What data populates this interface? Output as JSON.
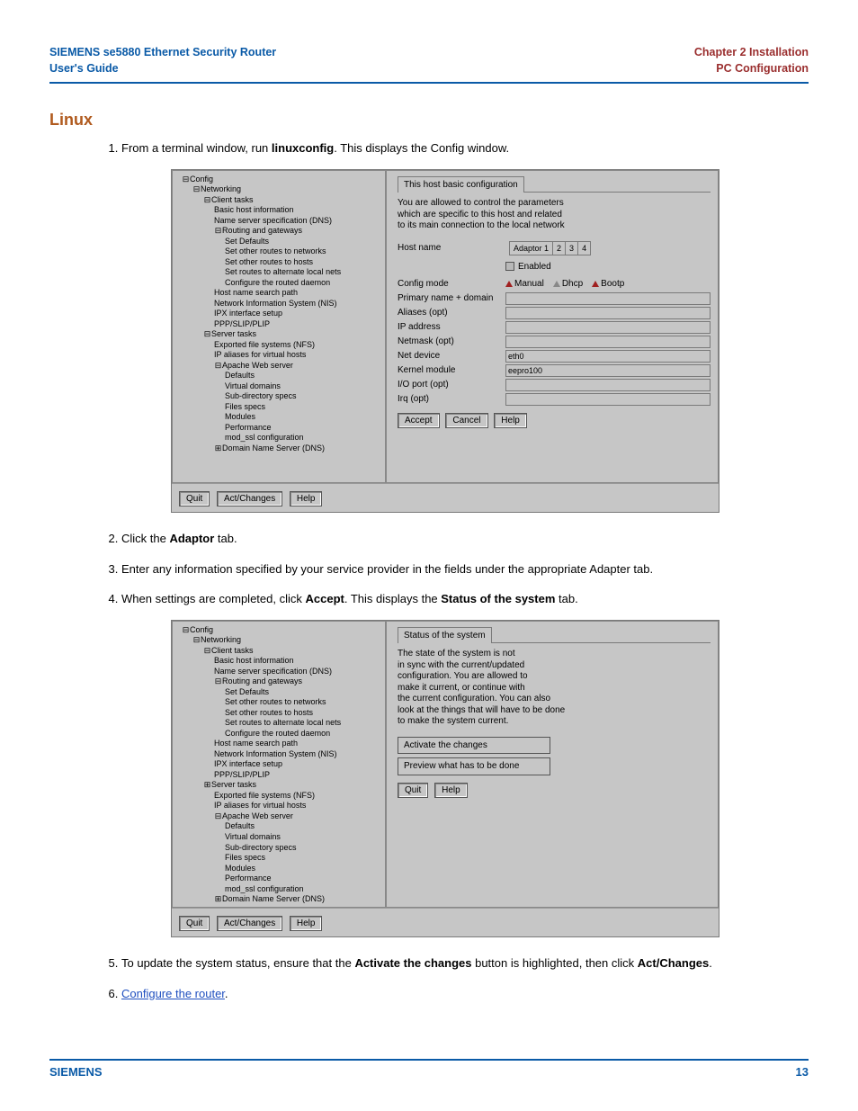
{
  "header": {
    "product_line1": "SIEMENS se5880 Ethernet Security Router",
    "product_line2": "User's Guide",
    "chapter_line1": "Chapter 2  Installation",
    "chapter_line2": "PC Configuration"
  },
  "section_title": "Linux",
  "steps": {
    "s1_pre": "From a terminal window, run ",
    "s1_bold": "linuxconfig",
    "s1_post": ". This displays the Config window.",
    "s2_pre": "Click the ",
    "s2_bold": "Adaptor",
    "s2_post": " tab.",
    "s3": "Enter any information specified by your service provider in the fields under the appropriate Adapter tab.",
    "s4_a": "When settings are completed, click ",
    "s4_b": "Accept",
    "s4_c": ". This displays the ",
    "s4_d": "Status of the system",
    "s4_e": " tab.",
    "s5_a": "To update the system status, ensure that the ",
    "s5_b": "Activate the changes",
    "s5_c": " button is highlighted, then click ",
    "s5_d": "Act/Changes",
    "s5_e": ".",
    "s6_link": "Configure the router",
    "s6_post": "."
  },
  "tree": {
    "config": "Config",
    "networking": "Networking",
    "client_tasks": "Client tasks",
    "basic_host": "Basic host information",
    "dns_spec": "Name server specification (DNS)",
    "routing": "Routing and gateways",
    "set_defaults": "Set Defaults",
    "routes_nets": "Set other routes to networks",
    "routes_hosts": "Set other routes to hosts",
    "routes_alt": "Set routes to alternate local nets",
    "routed": "Configure the routed daemon",
    "host_search": "Host name search path",
    "nis": "Network Information System (NIS)",
    "ipx": "IPX interface setup",
    "ppp": "PPP/SLIP/PLIP",
    "server_tasks": "Server tasks",
    "nfs": "Exported file systems (NFS)",
    "ip_aliases": "IP aliases for virtual hosts",
    "apache": "Apache Web server",
    "apache_defaults": "Defaults",
    "vdomains": "Virtual domains",
    "subdir": "Sub-directory specs",
    "files_specs": "Files specs",
    "modules": "Modules",
    "performance": "Performance",
    "mod_ssl": "mod_ssl configuration",
    "dns_server": "Domain Name Server (DNS)"
  },
  "shot1": {
    "tab_title": "This host basic configuration",
    "intro1": "You are allowed to control the parameters",
    "intro2": "which are specific to this host and related",
    "intro3": "to its main connection to the local network",
    "hostname_label": "Host name",
    "adaptor1": "Adaptor 1",
    "t2": "2",
    "t3": "3",
    "t4": "4",
    "enabled": "Enabled",
    "config_mode_label": "Config mode",
    "manual": "Manual",
    "dhcp": "Dhcp",
    "bootp": "Bootp",
    "primary": "Primary name + domain",
    "aliases": "Aliases (opt)",
    "ipaddr": "IP address",
    "netmask": "Netmask (opt)",
    "netdev": "Net device",
    "netdev_val": "eth0",
    "kmod": "Kernel module",
    "kmod_val": "eepro100",
    "ioport": "I/O port (opt)",
    "irq": "Irq (opt)",
    "accept": "Accept",
    "cancel": "Cancel",
    "help": "Help"
  },
  "shot2": {
    "tab_title": "Status of the system",
    "l1": "The state of the system is not",
    "l2": "in sync with the current/updated",
    "l3": "configuration. You are allowed to",
    "l4": "make it current, or continue with",
    "l5": "the current configuration. You can also",
    "l6": "look at the things that will have to be done",
    "l7": "to make the system current.",
    "btn_activate": "Activate the changes",
    "btn_preview": "Preview what has to be done",
    "quit": "Quit",
    "help": "Help"
  },
  "bottom_buttons": {
    "quit": "Quit",
    "act": "Act/Changes",
    "help": "Help"
  },
  "footer": {
    "brand": "SIEMENS",
    "page": "13"
  }
}
